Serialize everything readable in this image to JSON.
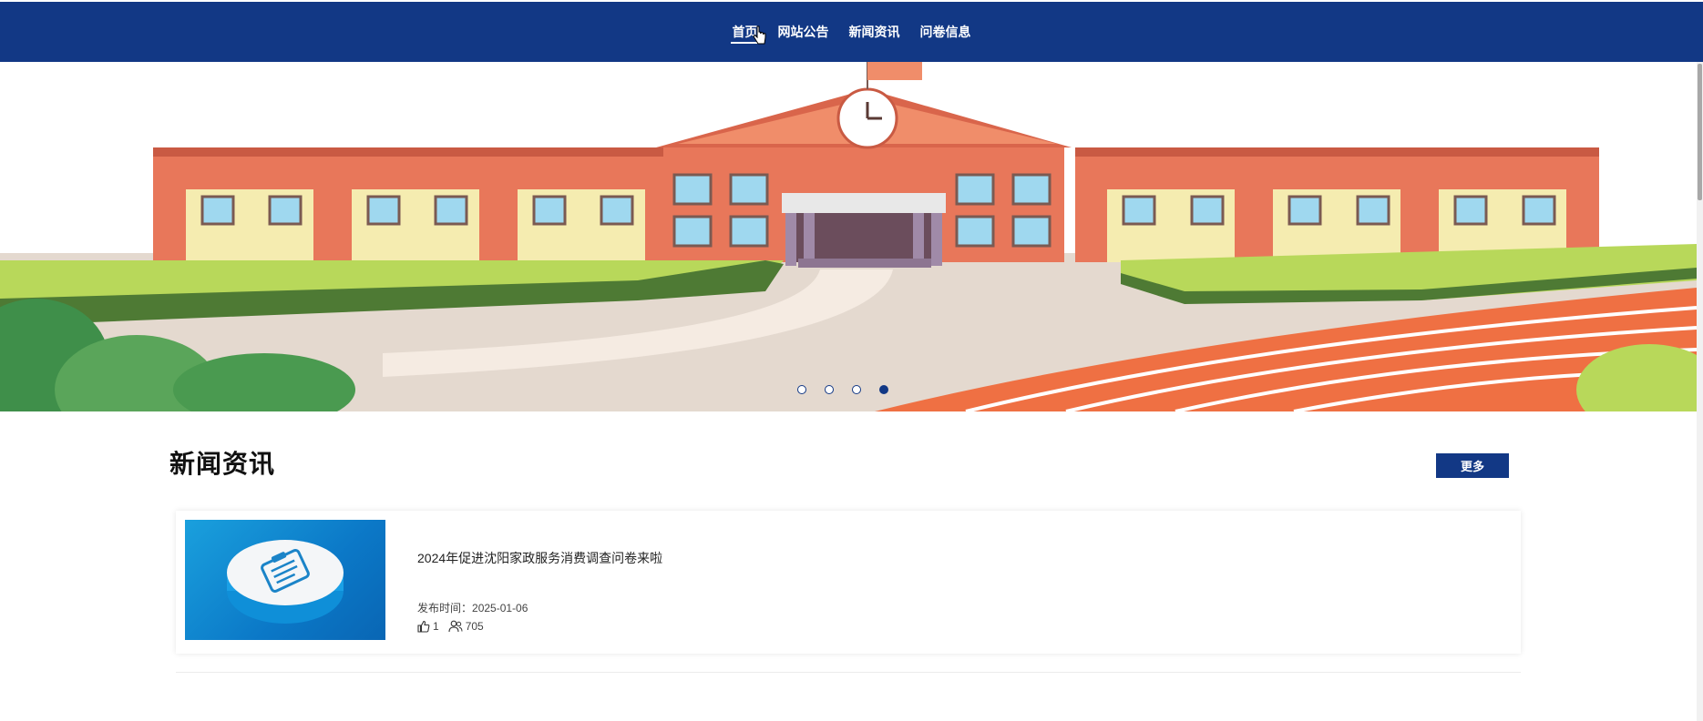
{
  "nav": {
    "items": [
      {
        "label": "首页",
        "active": true
      },
      {
        "label": "网站公告",
        "active": false
      },
      {
        "label": "新闻资讯",
        "active": false
      },
      {
        "label": "问卷信息",
        "active": false
      }
    ]
  },
  "banner": {
    "slide_count": 4,
    "active_slide": 4
  },
  "news": {
    "title": "新闻资讯",
    "more_label": "更多",
    "items": [
      {
        "title": "2024年促进沈阳家政服务消费调查问卷来啦",
        "date_label": "发布时间：",
        "date": "2025-01-06",
        "likes": "1",
        "views": "705"
      }
    ]
  },
  "colors": {
    "brand": "#123885",
    "track": "#ef7043",
    "building": "#e8775a"
  },
  "icons": [
    "thumbs-up-icon",
    "users-icon",
    "clipboard-icon",
    "pointer-cursor-icon"
  ]
}
